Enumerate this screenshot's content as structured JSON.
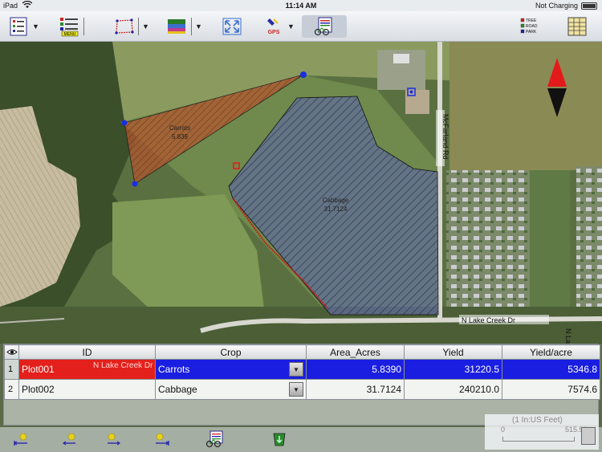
{
  "status": {
    "device": "iPad",
    "time": "11:14 AM",
    "battery": "Not Charging"
  },
  "toolbar": {
    "menu_badge": "MENU",
    "legend_lines": [
      "TREE",
      "ROAD",
      "PARK"
    ],
    "gps_label": "GPS"
  },
  "map": {
    "polygons": [
      {
        "name": "Carrots",
        "value": "5.839"
      },
      {
        "name": "Cabbage",
        "value": "31.7124"
      }
    ],
    "roads": [
      "McFarland Rd",
      "N Lake Creek Dr",
      "N Lake Creek Dr"
    ]
  },
  "table": {
    "columns": [
      "ID",
      "Crop",
      "Area_Acres",
      "Yield",
      "Yield/acre"
    ],
    "rows": [
      {
        "num": "1",
        "id": "Plot001",
        "crop": "Carrots",
        "area": "5.8390",
        "yield": "31220.5",
        "per_acre": "5346.8"
      },
      {
        "num": "2",
        "id": "Plot002",
        "crop": "Cabbage",
        "area": "31.7124",
        "yield": "240210.0",
        "per_acre": "7574.6"
      }
    ]
  },
  "scale": {
    "unit": "(1 In:US Feet)",
    "min": "0",
    "max": "515.91"
  },
  "colors": {
    "selected_id": "#e3201b",
    "selected_row": "#1a1ee0",
    "carrots_fill": "#b85a33",
    "cabbage_fill": "#4a5a8a"
  }
}
